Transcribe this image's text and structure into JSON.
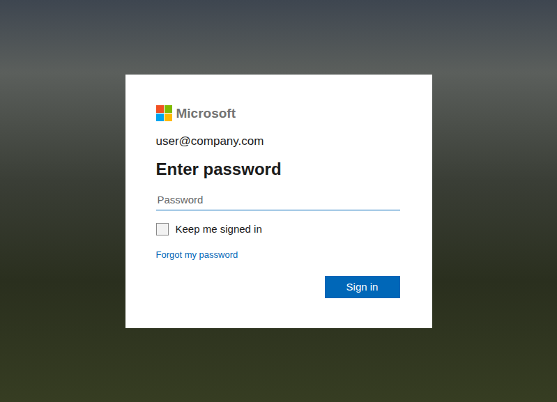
{
  "logo": {
    "name": "Microsoft"
  },
  "account": "user@company.com",
  "heading": "Enter password",
  "password": {
    "placeholder": "Password",
    "value": "",
    "focused": true
  },
  "keep_signed_in": {
    "label": "Keep me signed in",
    "checked": false
  },
  "links": [
    {
      "label": "Forgot my password"
    }
  ],
  "buttons": [
    {
      "label": "Sign in"
    }
  ]
}
